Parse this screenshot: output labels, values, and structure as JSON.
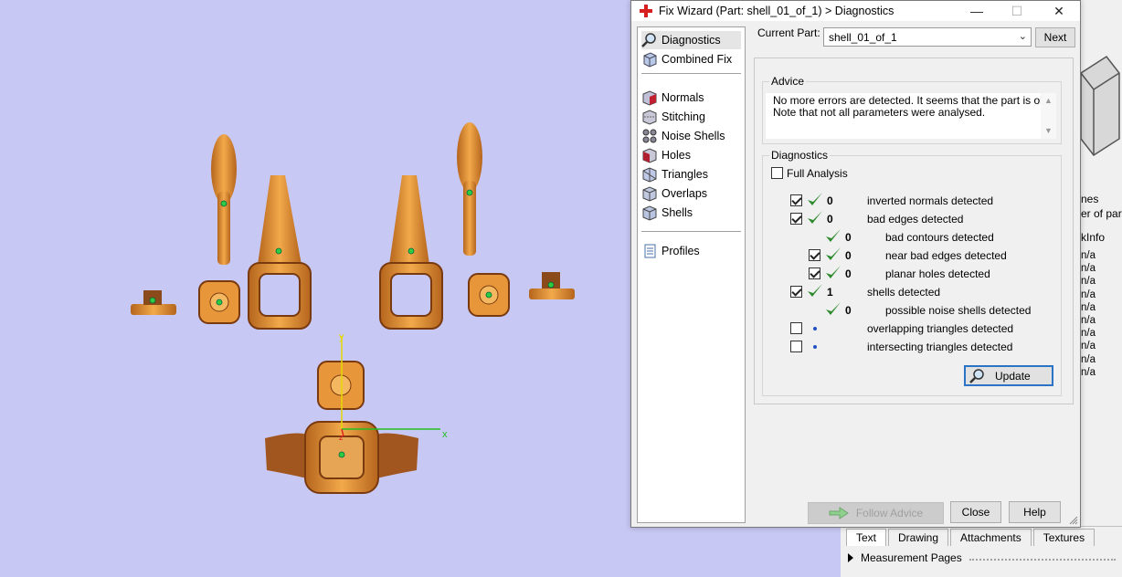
{
  "dialog": {
    "title": "Fix Wizard (Part: shell_01_of_1) > Diagnostics",
    "window_buttons": {
      "minimize": "—",
      "maximize": "☐",
      "close": "✕"
    },
    "nav_items": [
      {
        "label": "Diagnostics",
        "icon": "magnifier-icon",
        "selected": true
      },
      {
        "label": "Combined Fix",
        "icon": "combined-fix-icon"
      },
      {
        "label": "Normals",
        "icon": "normals-icon"
      },
      {
        "label": "Stitching",
        "icon": "stitching-icon"
      },
      {
        "label": "Noise Shells",
        "icon": "noise-shells-icon"
      },
      {
        "label": "Holes",
        "icon": "holes-icon"
      },
      {
        "label": "Triangles",
        "icon": "triangles-icon"
      },
      {
        "label": "Overlaps",
        "icon": "overlaps-icon"
      },
      {
        "label": "Shells",
        "icon": "shells-icon"
      },
      {
        "label": "Profiles",
        "icon": "profiles-icon"
      }
    ],
    "current_part_label": "Current Part:",
    "current_part_value": "shell_01_of_1",
    "next_button": "Next",
    "advice": {
      "title": "Advice",
      "text_line1": "No more errors are detected. It seems that the part is ok.",
      "text_line2": "Note that not all parameters were analysed."
    },
    "diagnostics": {
      "title": "Diagnostics",
      "full_analysis_label": "Full Analysis",
      "full_analysis_checked": false,
      "rows": [
        {
          "checkbox": true,
          "checked": true,
          "status": "ok",
          "count": "0",
          "label": "inverted normals detected",
          "indent": 0
        },
        {
          "checkbox": true,
          "checked": true,
          "status": "ok",
          "count": "0",
          "label": "bad edges detected",
          "indent": 0
        },
        {
          "checkbox": false,
          "checked": false,
          "status": "ok",
          "count": "0",
          "label": "bad contours detected",
          "indent": 1
        },
        {
          "checkbox": true,
          "checked": true,
          "status": "ok",
          "count": "0",
          "label": "near bad edges detected",
          "indent": 1
        },
        {
          "checkbox": true,
          "checked": true,
          "status": "ok",
          "count": "0",
          "label": "planar holes detected",
          "indent": 1
        },
        {
          "checkbox": true,
          "checked": true,
          "status": "ok",
          "count": "1",
          "label": "shells detected",
          "indent": 0
        },
        {
          "checkbox": false,
          "checked": false,
          "status": "ok",
          "count": "0",
          "label": "possible noise shells detected",
          "indent": 1
        },
        {
          "checkbox": true,
          "checked": false,
          "status": "pending",
          "count": "",
          "label": "overlapping triangles detected",
          "indent": 0
        },
        {
          "checkbox": true,
          "checked": false,
          "status": "pending",
          "count": "",
          "label": "intersecting triangles detected",
          "indent": 0
        }
      ]
    },
    "update_button": "Update",
    "follow_advice_button": "Follow Advice",
    "close_button": "Close",
    "help_button": "Help"
  },
  "viewport": {
    "axis_x_label": "x",
    "axis_y_label": "y",
    "axis_z_label": "z",
    "background_color": "#c8c8f5",
    "part_color": "#e8963a"
  },
  "right_panel": {
    "text_nes": "nes",
    "text_er_of_parts": "er of parts",
    "text_kinfo": "kInfo",
    "list_values": [
      "n/a",
      "n/a",
      "n/a",
      "n/a",
      "n/a",
      "n/a",
      "n/a",
      "n/a",
      "n/a",
      "n/a"
    ]
  },
  "bottom_panel": {
    "tabs": [
      "Text",
      "Drawing",
      "Attachments",
      "Textures"
    ],
    "measurement_pages": "Measurement Pages"
  },
  "colors": {
    "check_green": "#2e8b2e",
    "accent_blue": "#2b73c4",
    "app_red": "#d62020"
  }
}
